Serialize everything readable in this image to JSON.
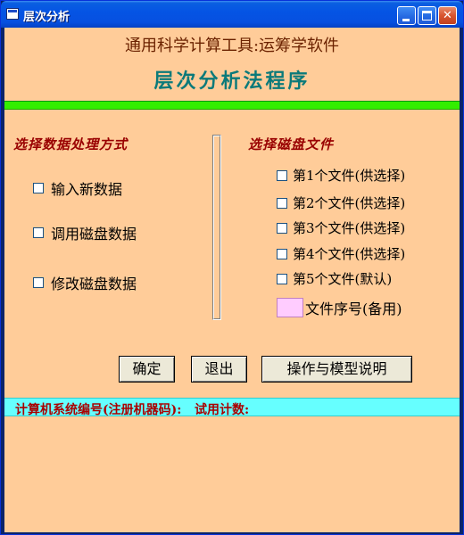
{
  "window": {
    "title": "层次分析",
    "controls": {
      "minimize": "_",
      "maximize": "□",
      "close": "✕"
    }
  },
  "header": {
    "line1": "通用科学计算工具:运筹学软件",
    "line2": "层次分析法程序"
  },
  "left_panel": {
    "title": "选择数据处理方式",
    "options": [
      {
        "label": "输入新数据",
        "checked": false
      },
      {
        "label": "调用磁盘数据",
        "checked": false
      },
      {
        "label": "修改磁盘数据",
        "checked": false
      }
    ]
  },
  "right_panel": {
    "title": "选择磁盘文件",
    "files": [
      {
        "label": "第1个文件(供选择)",
        "checked": false
      },
      {
        "label": "第2个文件(供选择)",
        "checked": false
      },
      {
        "label": "第3个文件(供选择)",
        "checked": false
      },
      {
        "label": "第4个文件(供选择)",
        "checked": false
      },
      {
        "label": "第5个文件(默认)",
        "checked": false
      }
    ],
    "sequence_label": "文件序号(备用)",
    "sequence_value": ""
  },
  "buttons": {
    "confirm": "确定",
    "exit": "退出",
    "help": "操作与模型说明"
  },
  "status": {
    "text": "计算机系统编号(注册机器码):   试用计数:"
  },
  "colors": {
    "client_bg": "#ffcc99",
    "green_bar": "#33ee00",
    "status_bar": "#66ffff",
    "header_title": "#0b7a7a",
    "section_title": "#990000",
    "sequence_box": "#ffccff"
  }
}
